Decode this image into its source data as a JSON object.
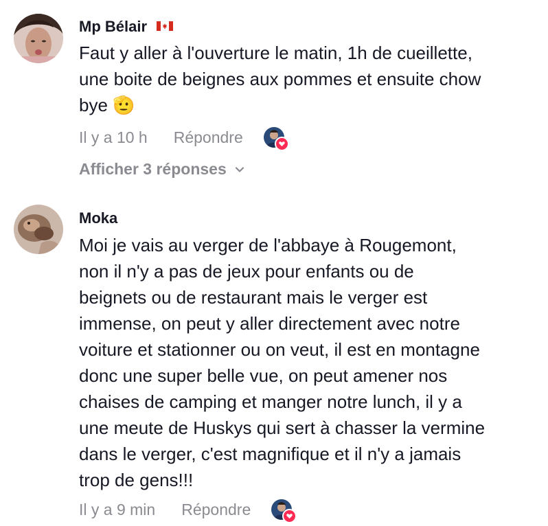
{
  "comments": [
    {
      "username": "Mp Bélair",
      "flag_icon": "canada-flag-icon",
      "text": "Faut y aller à l'ouverture le matin, 1h de cueillette,\nune boite de beignes aux pommes et ensuite chow\nbye 🫡",
      "time": "Il y a 10 h",
      "reply_label": "Répondre",
      "show_replies_label": "Afficher 3 réponses",
      "liked_by_creator": true
    },
    {
      "username": "Moka",
      "text": "Moi je vais au verger de l'abbaye à Rougemont,\nnon il n'y a pas de jeux pour enfants ou de\nbeignets ou de restaurant mais le verger est\nimmense, on peut y aller directement avec notre\nvoiture et stationner ou on veut, il est en montagne\ndonc une super belle vue, on peut amener nos\nchaises de camping et manger notre lunch, il y a\nune meute de Huskys qui sert à chasser la vermine\ndans le verger, c'est magnifique et il n'y a jamais\ntrop de gens!!!",
      "time": "Il y a 9 min",
      "reply_label": "Répondre",
      "liked_by_creator": true
    }
  ],
  "colors": {
    "text_primary": "#161823",
    "text_secondary": "#8a8b91",
    "heart_badge": "#fe2c55",
    "flag_red": "#d52b1e"
  },
  "icons": {
    "chevron": "chevron-down-icon",
    "heart": "heart-icon"
  }
}
